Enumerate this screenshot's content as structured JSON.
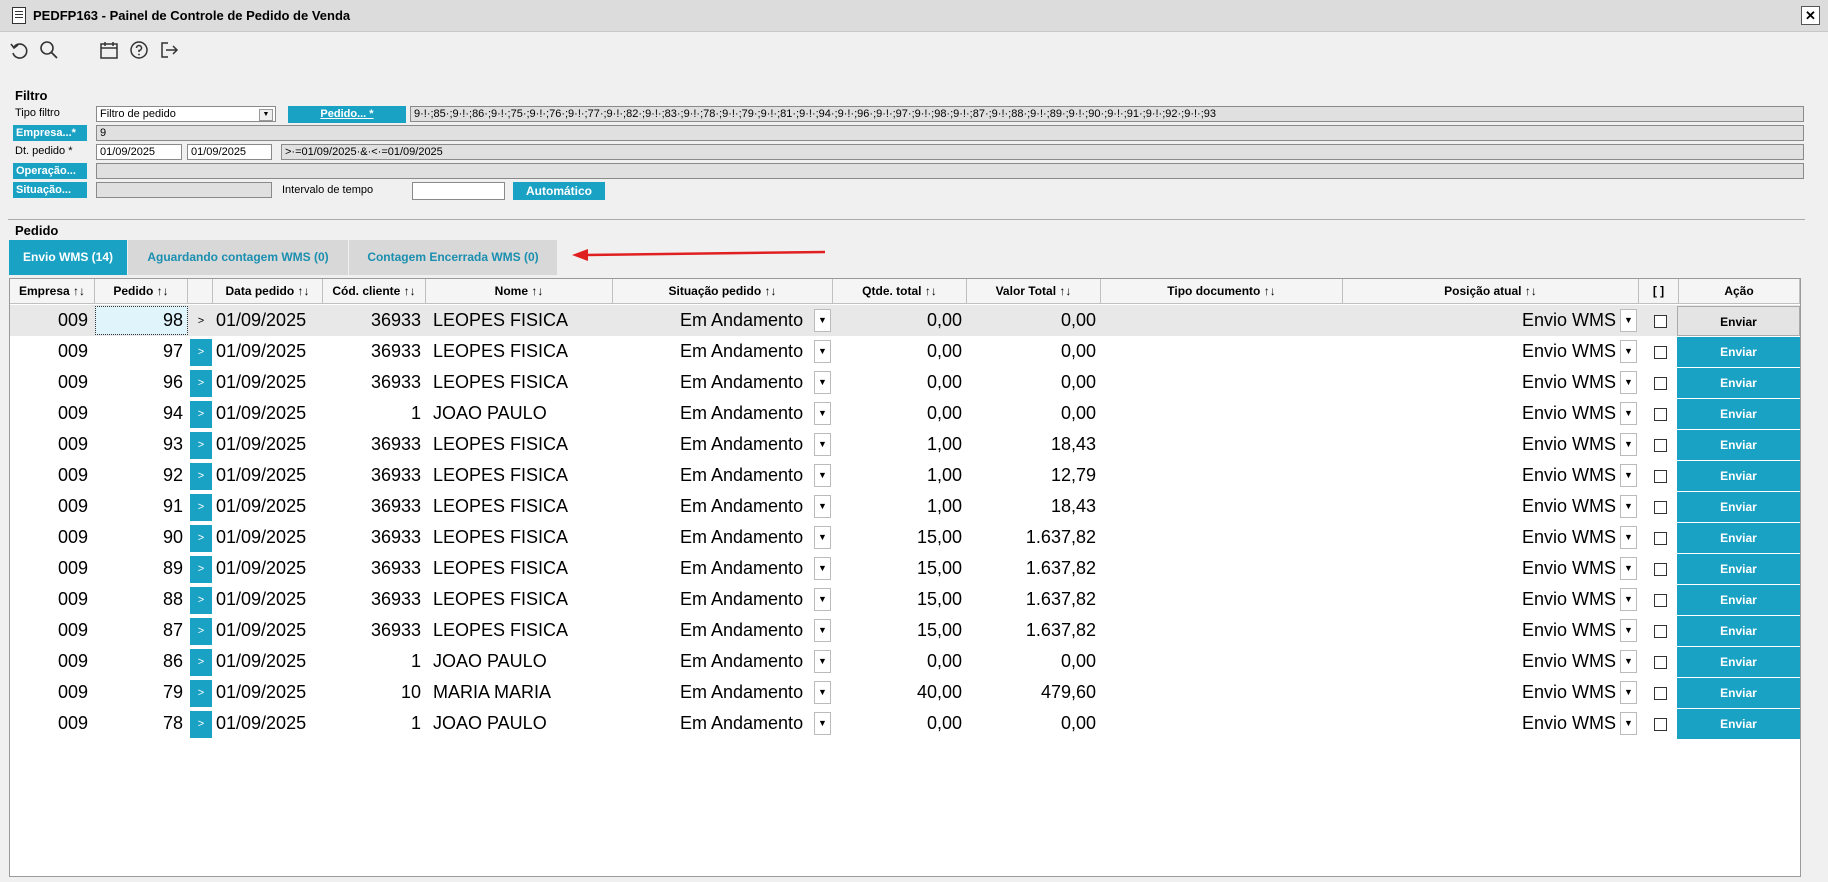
{
  "window": {
    "title": "PEDFP163 - Painel de Controle de Pedido de Venda",
    "close_label": "✕"
  },
  "toolbar": {
    "icons": [
      "undo-icon",
      "search-icon",
      "calendar-icon",
      "help-icon",
      "exit-icon"
    ]
  },
  "filter": {
    "section_title": "Filtro",
    "tipo_filtro_label": "Tipo filtro",
    "tipo_filtro_value": "Filtro de pedido",
    "pedido_button": "Pedido... *",
    "pedido_list": "9·!·;85·;9·!·;86·;9·!·;75·;9·!·;76·;9·!·;77·;9·!·;82·;9·!·;83·;9·!·;78·;9·!·;79·;9·!·;81·;9·!·;94·;9·!·;96·;9·!·;97·;9·!·;98·;9·!·;87·;9·!·;88·;9·!·;89·;9·!·;90·;9·!·;91·;9·!·;92·;9·!·;93",
    "empresa_button": "Empresa...*",
    "empresa_value": "9",
    "dt_pedido_label": "Dt. pedido *",
    "dt_from": "01/09/2025",
    "dt_to": "01/09/2025",
    "dt_expr": ">·=01/09/2025·&·<·=01/09/2025",
    "operacao_button": "Operação...",
    "situacao_button": "Situação...",
    "intervalo_label": "Intervalo de tempo",
    "intervalo_value": "",
    "automatico_button": "Automático"
  },
  "pedido_section": {
    "title": "Pedido",
    "tabs": [
      {
        "label": "Envio WMS (14)"
      },
      {
        "label": "Aguardando contagem WMS (0)"
      },
      {
        "label": "Contagem Encerrada WMS (0)"
      }
    ]
  },
  "colors": {
    "accent": "#1aa2c4",
    "annotation_arrow": "#e02020"
  },
  "table": {
    "headers": {
      "empresa": "Empresa ↑↓",
      "pedido": "Pedido ↑↓",
      "data": "Data pedido ↑↓",
      "cliente": "Cód. cliente ↑↓",
      "nome": "Nome ↑↓",
      "situacao": "Situação pedido ↑↓",
      "qtde": "Qtde. total ↑↓",
      "valor": "Valor Total ↑↓",
      "tipo": "Tipo documento ↑↓",
      "posicao": "Posição atual ↑↓",
      "check": "[ ]",
      "acao": "Ação"
    },
    "rows": [
      {
        "empresa": "009",
        "pedido": "98",
        "data": "01/09/2025",
        "cliente": "36933",
        "nome": "LEOPES FISICA",
        "situacao": "Em Andamento",
        "qtde": "0,00",
        "valor": "0,00",
        "tipo": "",
        "posicao": "Envio WMS",
        "acao": "Enviar"
      },
      {
        "empresa": "009",
        "pedido": "97",
        "data": "01/09/2025",
        "cliente": "36933",
        "nome": "LEOPES FISICA",
        "situacao": "Em Andamento",
        "qtde": "0,00",
        "valor": "0,00",
        "tipo": "",
        "posicao": "Envio WMS",
        "acao": "Enviar"
      },
      {
        "empresa": "009",
        "pedido": "96",
        "data": "01/09/2025",
        "cliente": "36933",
        "nome": "LEOPES FISICA",
        "situacao": "Em Andamento",
        "qtde": "0,00",
        "valor": "0,00",
        "tipo": "",
        "posicao": "Envio WMS",
        "acao": "Enviar"
      },
      {
        "empresa": "009",
        "pedido": "94",
        "data": "01/09/2025",
        "cliente": "1",
        "nome": "JOAO PAULO",
        "situacao": "Em Andamento",
        "qtde": "0,00",
        "valor": "0,00",
        "tipo": "",
        "posicao": "Envio WMS",
        "acao": "Enviar"
      },
      {
        "empresa": "009",
        "pedido": "93",
        "data": "01/09/2025",
        "cliente": "36933",
        "nome": "LEOPES FISICA",
        "situacao": "Em Andamento",
        "qtde": "1,00",
        "valor": "18,43",
        "tipo": "",
        "posicao": "Envio WMS",
        "acao": "Enviar"
      },
      {
        "empresa": "009",
        "pedido": "92",
        "data": "01/09/2025",
        "cliente": "36933",
        "nome": "LEOPES FISICA",
        "situacao": "Em Andamento",
        "qtde": "1,00",
        "valor": "12,79",
        "tipo": "",
        "posicao": "Envio WMS",
        "acao": "Enviar"
      },
      {
        "empresa": "009",
        "pedido": "91",
        "data": "01/09/2025",
        "cliente": "36933",
        "nome": "LEOPES FISICA",
        "situacao": "Em Andamento",
        "qtde": "1,00",
        "valor": "18,43",
        "tipo": "",
        "posicao": "Envio WMS",
        "acao": "Enviar"
      },
      {
        "empresa": "009",
        "pedido": "90",
        "data": "01/09/2025",
        "cliente": "36933",
        "nome": "LEOPES FISICA",
        "situacao": "Em Andamento",
        "qtde": "15,00",
        "valor": "1.637,82",
        "tipo": "",
        "posicao": "Envio WMS",
        "acao": "Enviar"
      },
      {
        "empresa": "009",
        "pedido": "89",
        "data": "01/09/2025",
        "cliente": "36933",
        "nome": "LEOPES FISICA",
        "situacao": "Em Andamento",
        "qtde": "15,00",
        "valor": "1.637,82",
        "tipo": "",
        "posicao": "Envio WMS",
        "acao": "Enviar"
      },
      {
        "empresa": "009",
        "pedido": "88",
        "data": "01/09/2025",
        "cliente": "36933",
        "nome": "LEOPES FISICA",
        "situacao": "Em Andamento",
        "qtde": "15,00",
        "valor": "1.637,82",
        "tipo": "",
        "posicao": "Envio WMS",
        "acao": "Enviar"
      },
      {
        "empresa": "009",
        "pedido": "87",
        "data": "01/09/2025",
        "cliente": "36933",
        "nome": "LEOPES FISICA",
        "situacao": "Em Andamento",
        "qtde": "15,00",
        "valor": "1.637,82",
        "tipo": "",
        "posicao": "Envio WMS",
        "acao": "Enviar"
      },
      {
        "empresa": "009",
        "pedido": "86",
        "data": "01/09/2025",
        "cliente": "1",
        "nome": "JOAO PAULO",
        "situacao": "Em Andamento",
        "qtde": "0,00",
        "valor": "0,00",
        "tipo": "",
        "posicao": "Envio WMS",
        "acao": "Enviar"
      },
      {
        "empresa": "009",
        "pedido": "79",
        "data": "01/09/2025",
        "cliente": "10",
        "nome": "MARIA MARIA",
        "situacao": "Em Andamento",
        "qtde": "40,00",
        "valor": "479,60",
        "tipo": "",
        "posicao": "Envio WMS",
        "acao": "Enviar"
      },
      {
        "empresa": "009",
        "pedido": "78",
        "data": "01/09/2025",
        "cliente": "1",
        "nome": "JOAO PAULO",
        "situacao": "Em Andamento",
        "qtde": "0,00",
        "valor": "0,00",
        "tipo": "",
        "posicao": "Envio WMS",
        "acao": "Enviar"
      }
    ]
  }
}
